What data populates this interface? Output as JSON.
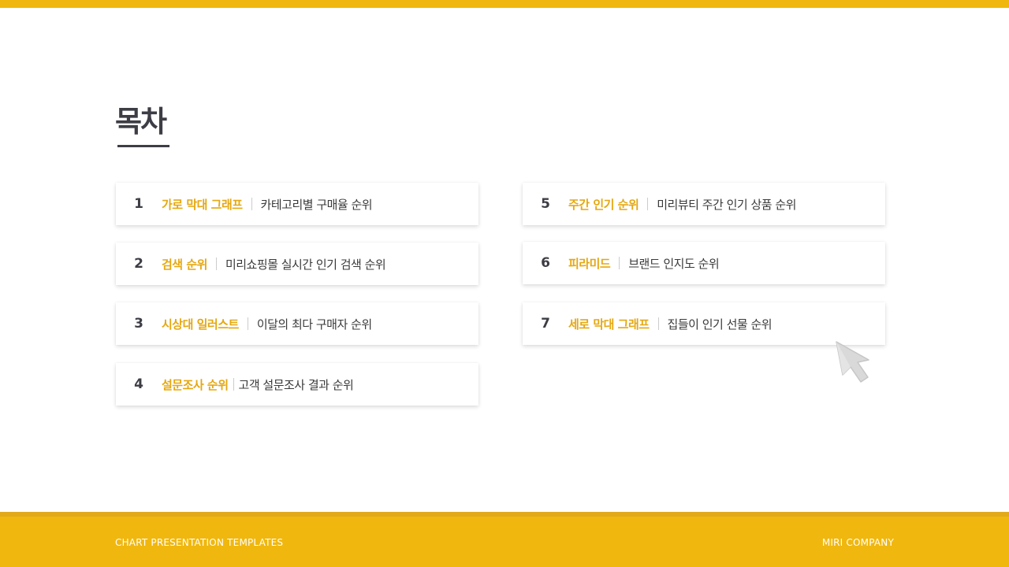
{
  "page": {
    "title": "목차"
  },
  "toc": {
    "items": [
      {
        "num": "1",
        "name": "가로 막대 그래프",
        "desc": "카테고리별 구매율 순위"
      },
      {
        "num": "2",
        "name": "검색 순위",
        "desc": "미리쇼핑몰 실시간 인기 검색 순위"
      },
      {
        "num": "3",
        "name": "시상대 일러스트",
        "desc": "이달의 최다 구매자 순위"
      },
      {
        "num": "4",
        "name": "설문조사 순위",
        "desc": "고객 설문조사 결과 순위"
      },
      {
        "num": "5",
        "name": "주간 인기 순위",
        "desc": "미리뷰티 주간 인기 상품 순위"
      },
      {
        "num": "6",
        "name": "피라미드",
        "desc": "브랜드 인지도 순위"
      },
      {
        "num": "7",
        "name": "세로 막대 그래프",
        "desc": "집들이 인기 선물 순위"
      }
    ]
  },
  "footer": {
    "left": "CHART PRESENTATION TEMPLATES",
    "right": "MIRI COMPANY"
  },
  "colors": {
    "accent": "#f0b70e",
    "accent_text": "#e5a812",
    "heading": "#3d3d45"
  },
  "icons": {
    "cursor": "mouse-pointer-icon"
  }
}
